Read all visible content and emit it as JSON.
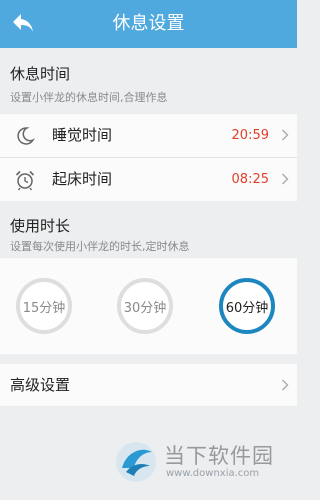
{
  "header": {
    "title": "休息设置",
    "back_icon": "back-arrow-icon"
  },
  "rest_time": {
    "title": "休息时间",
    "subtitle": "设置小伴龙的休息时间,合理作息",
    "items": [
      {
        "label": "睡觉时间",
        "value": "20:59",
        "icon": "moon-icon"
      },
      {
        "label": "起床时间",
        "value": "08:25",
        "icon": "alarm-clock-icon"
      }
    ]
  },
  "usage": {
    "title": "使用时长",
    "subtitle": "设置每次使用小伴龙的时长,定时休息",
    "options": [
      {
        "label": "15分钟",
        "selected": false
      },
      {
        "label": "30分钟",
        "selected": false
      },
      {
        "label": "60分钟",
        "selected": true
      }
    ]
  },
  "advanced": {
    "label": "高级设置"
  },
  "watermark": {
    "text": "当下软件园",
    "url": "www.downxia.com"
  },
  "colors": {
    "accent": "#4fa9de",
    "time_value": "#e0402a",
    "selected_ring": "#1d86bf",
    "unselected_ring": "#dedede"
  }
}
